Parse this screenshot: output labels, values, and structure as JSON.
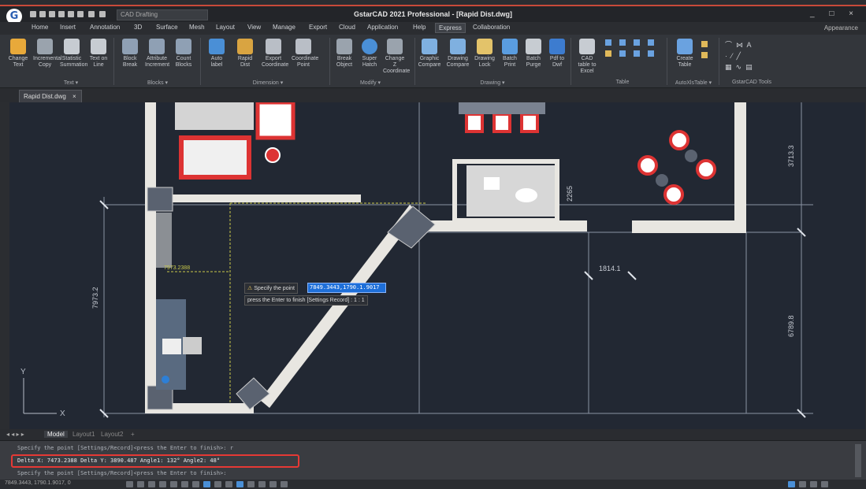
{
  "window": {
    "title": "GstarCAD 2021 Professional - [Rapid Dist.dwg]",
    "quick_access_combo": "CAD Drafting",
    "controls": "_ □ ×"
  },
  "menu": {
    "items": [
      "Home",
      "Insert",
      "Annotation",
      "3D",
      "Surface",
      "Mesh",
      "Layout",
      "View",
      "Manage",
      "Export",
      "Cloud",
      "Application",
      "Help",
      "Express",
      "Collaboration"
    ],
    "active": "Express",
    "appearance": "Appearance"
  },
  "ribbon": {
    "buttons": [
      {
        "label": "Change Text",
        "icon": "change-text-icon"
      },
      {
        "label": "Incremental Copy",
        "icon": "incremental-copy-icon"
      },
      {
        "label": "Statistic Summation",
        "icon": "summation-icon"
      },
      {
        "label": "Text on Line",
        "icon": "text-on-line-icon"
      },
      {
        "label": "Block Break",
        "icon": "block-break-icon"
      },
      {
        "label": "Attribute Increment",
        "icon": "attribute-increment-icon"
      },
      {
        "label": "Count Blocks",
        "icon": "count-blocks-icon"
      },
      {
        "label": "Auto label",
        "icon": "auto-label-icon"
      },
      {
        "label": "Rapid Dist",
        "icon": "rapid-dist-icon"
      },
      {
        "label": "Export Coordinate",
        "icon": "export-coordinate-icon"
      },
      {
        "label": "Coordinate Point",
        "icon": "coordinate-point-icon"
      },
      {
        "label": "Break Object",
        "icon": "break-object-icon"
      },
      {
        "label": "Super Hatch",
        "icon": "super-hatch-icon"
      },
      {
        "label": "Change Z Coordinate",
        "icon": "change-z-icon"
      },
      {
        "label": "Graphic Compare",
        "icon": "graphic-compare-icon"
      },
      {
        "label": "Drawing Compare",
        "icon": "drawing-compare-icon"
      },
      {
        "label": "Drawing Lock",
        "icon": "drawing-lock-icon"
      },
      {
        "label": "Batch Print",
        "icon": "batch-print-icon"
      },
      {
        "label": "Batch Purge",
        "icon": "batch-purge-icon"
      },
      {
        "label": "Pdf to Dwf",
        "icon": "pdf-to-dwf-icon"
      },
      {
        "label": "CAD table to Excel",
        "icon": "cad-table-excel-icon"
      },
      {
        "label": "Create Table",
        "icon": "create-table-icon"
      }
    ],
    "groups": [
      "Text ▾",
      "Blocks ▾",
      "Dimension ▾",
      "Modify ▾",
      "Drawing ▾",
      "Table",
      "AutoXlsTable ▾",
      "GstarCAD Tools"
    ]
  },
  "document_tab": {
    "label": "Rapid Dist.dwg",
    "close": "×"
  },
  "drawing": {
    "dimensions": [
      "7973.2",
      "3713.3",
      "1814.1",
      "6789.8",
      "2265"
    ],
    "measure_label": "7973.2388"
  },
  "command_prompt": {
    "prompt": "Specify the point",
    "input_value": "7849.3443,1790.1.9017",
    "hint": "press the Enter to finish [Settings Record] : 1 : 1"
  },
  "layout_tabs": {
    "items": [
      "Model",
      "Layout1",
      "Layout2",
      "+"
    ],
    "active": "Model"
  },
  "command_line": {
    "line1": "Specify the point [Settings/Record]<press the Enter to finish>: r",
    "line2": "Delta X: 7473.2388  Delta Y: 3890.487  Angle1: 132°  Angle2: 48°",
    "line3": "Specify the point [Settings/Record]<press the Enter to finish>:"
  },
  "status_bar": {
    "coords": "7849.3443, 1790.1.9017, 0"
  }
}
